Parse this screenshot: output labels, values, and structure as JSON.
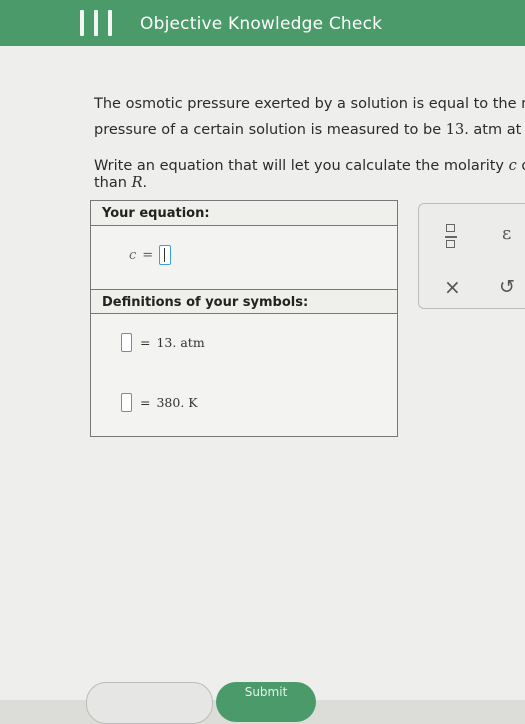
{
  "header": {
    "title": "Objective Knowledge Check"
  },
  "question": {
    "line1": "The osmotic pressure exerted by a solution is equal to the mo",
    "line2a": "pressure of a certain solution is measured to be ",
    "line2b": "13.",
    "line2c": " atm at ar",
    "line3a": "Write an equation that will let you calculate the molarity ",
    "line3b": "c",
    "line3c": " of",
    "line4a": "than ",
    "line4b": "R",
    "line4c": "."
  },
  "equation_box": {
    "heading": "Your equation:",
    "lhs": "c",
    "equals": "="
  },
  "definitions": {
    "heading": "Definitions of your symbols:",
    "items": [
      {
        "equals": "=",
        "value": "13. atm"
      },
      {
        "equals": "=",
        "value": "380. K"
      }
    ]
  },
  "toolbar": {
    "fraction_icon": "fraction-icon",
    "epsilon": "ε",
    "clear": "×",
    "undo": "↺"
  },
  "footer": {
    "submit_label": "Submit"
  }
}
